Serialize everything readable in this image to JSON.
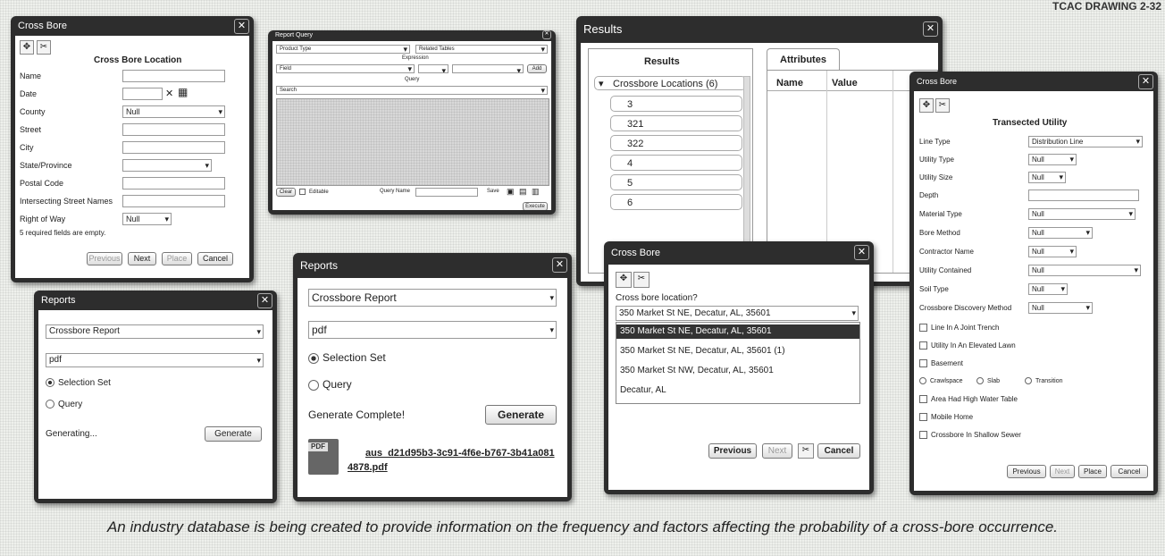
{
  "corner_text": "TCAC DRAWING 2-32",
  "caption": "An industry database is being created to provide information on the frequency and factors affecting the probability of a cross-bore occurrence.",
  "cross_bore_location": {
    "title": "Cross Bore",
    "heading": "Cross Bore Location",
    "fields": [
      {
        "label": "Name",
        "value": ""
      },
      {
        "label": "Date",
        "value": ""
      },
      {
        "label": "County",
        "value": "Null"
      },
      {
        "label": "Street",
        "value": ""
      },
      {
        "label": "City",
        "value": ""
      },
      {
        "label": "State/Province",
        "value": ""
      },
      {
        "label": "Postal Code",
        "value": ""
      },
      {
        "label": "Intersecting Street Names",
        "value": ""
      },
      {
        "label": "Right of Way",
        "value": "Null"
      }
    ],
    "status": "5 required fields are empty.",
    "buttons": [
      "Previous",
      "Next",
      "Place",
      "Cancel"
    ]
  },
  "report_query": {
    "title": "Report Query",
    "product_type": "Product Type",
    "related_tables": "Related Tables",
    "expression_label": "Expression",
    "field": "Field",
    "query_label": "Query",
    "search": "Search",
    "footer": [
      "Clear",
      "Editable",
      "Query Name",
      "Save",
      "Execute"
    ]
  },
  "results": {
    "title": "Results",
    "panel_title": "Results",
    "tab_attributes": "Attributes",
    "group": "Crossbore Locations (6)",
    "items": [
      "3",
      "321",
      "322",
      "4",
      "5",
      "6"
    ],
    "col_name": "Name",
    "col_value": "Value"
  },
  "reports_small": {
    "title": "Reports",
    "report": "Crossbore Report",
    "format": "pdf",
    "radio_selection": "Selection Set",
    "radio_query": "Query",
    "status": "Generating...",
    "generate": "Generate"
  },
  "reports_large": {
    "title": "Reports",
    "report": "Crossbore Report",
    "format": "pdf",
    "radio_selection": "Selection Set",
    "radio_query": "Query",
    "status": "Generate Complete!",
    "generate": "Generate",
    "pdf_badge": "PDF",
    "file_link": "aus_d21d95b3-3c91-4f6e-b767-3b41a0814878.pdf"
  },
  "cross_bore_address": {
    "title": "Cross Bore",
    "prompt": "Cross bore location?",
    "selected": "350 Market St NE, Decatur, AL, 35601",
    "options": [
      "350 Market St NE, Decatur, AL, 35601",
      "350 Market St NE, Decatur, AL, 35601 (1)",
      "350 Market St NW, Decatur, AL, 35601",
      "Decatur, AL"
    ],
    "buttons": [
      "Previous",
      "Next",
      "Cancel"
    ]
  },
  "transected_utility": {
    "title": "Cross Bore",
    "heading": "Transected Utility",
    "fields": [
      {
        "label": "Line Type",
        "value": "Distribution Line"
      },
      {
        "label": "Utility Type",
        "value": "Null"
      },
      {
        "label": "Utility Size",
        "value": "Null"
      },
      {
        "label": "Depth",
        "value": ""
      },
      {
        "label": "Material Type",
        "value": "Null"
      },
      {
        "label": "Bore Method",
        "value": "Null"
      },
      {
        "label": "Contractor Name",
        "value": "Null"
      },
      {
        "label": "Utility Contained",
        "value": "Null"
      },
      {
        "label": "Soil Type",
        "value": "Null"
      },
      {
        "label": "Crossbore Discovery Method",
        "value": "Null"
      }
    ],
    "checks": [
      "Line In A Joint Trench",
      "Utility In An Elevated Lawn",
      "Basement"
    ],
    "basement_options": [
      "Crawlspace",
      "Slab",
      "Transition"
    ],
    "checks2": [
      "Area Had High Water Table",
      "Mobile Home",
      "Crossbore In Shallow Sewer"
    ],
    "buttons": [
      "Previous",
      "Next",
      "Place",
      "Cancel"
    ]
  }
}
